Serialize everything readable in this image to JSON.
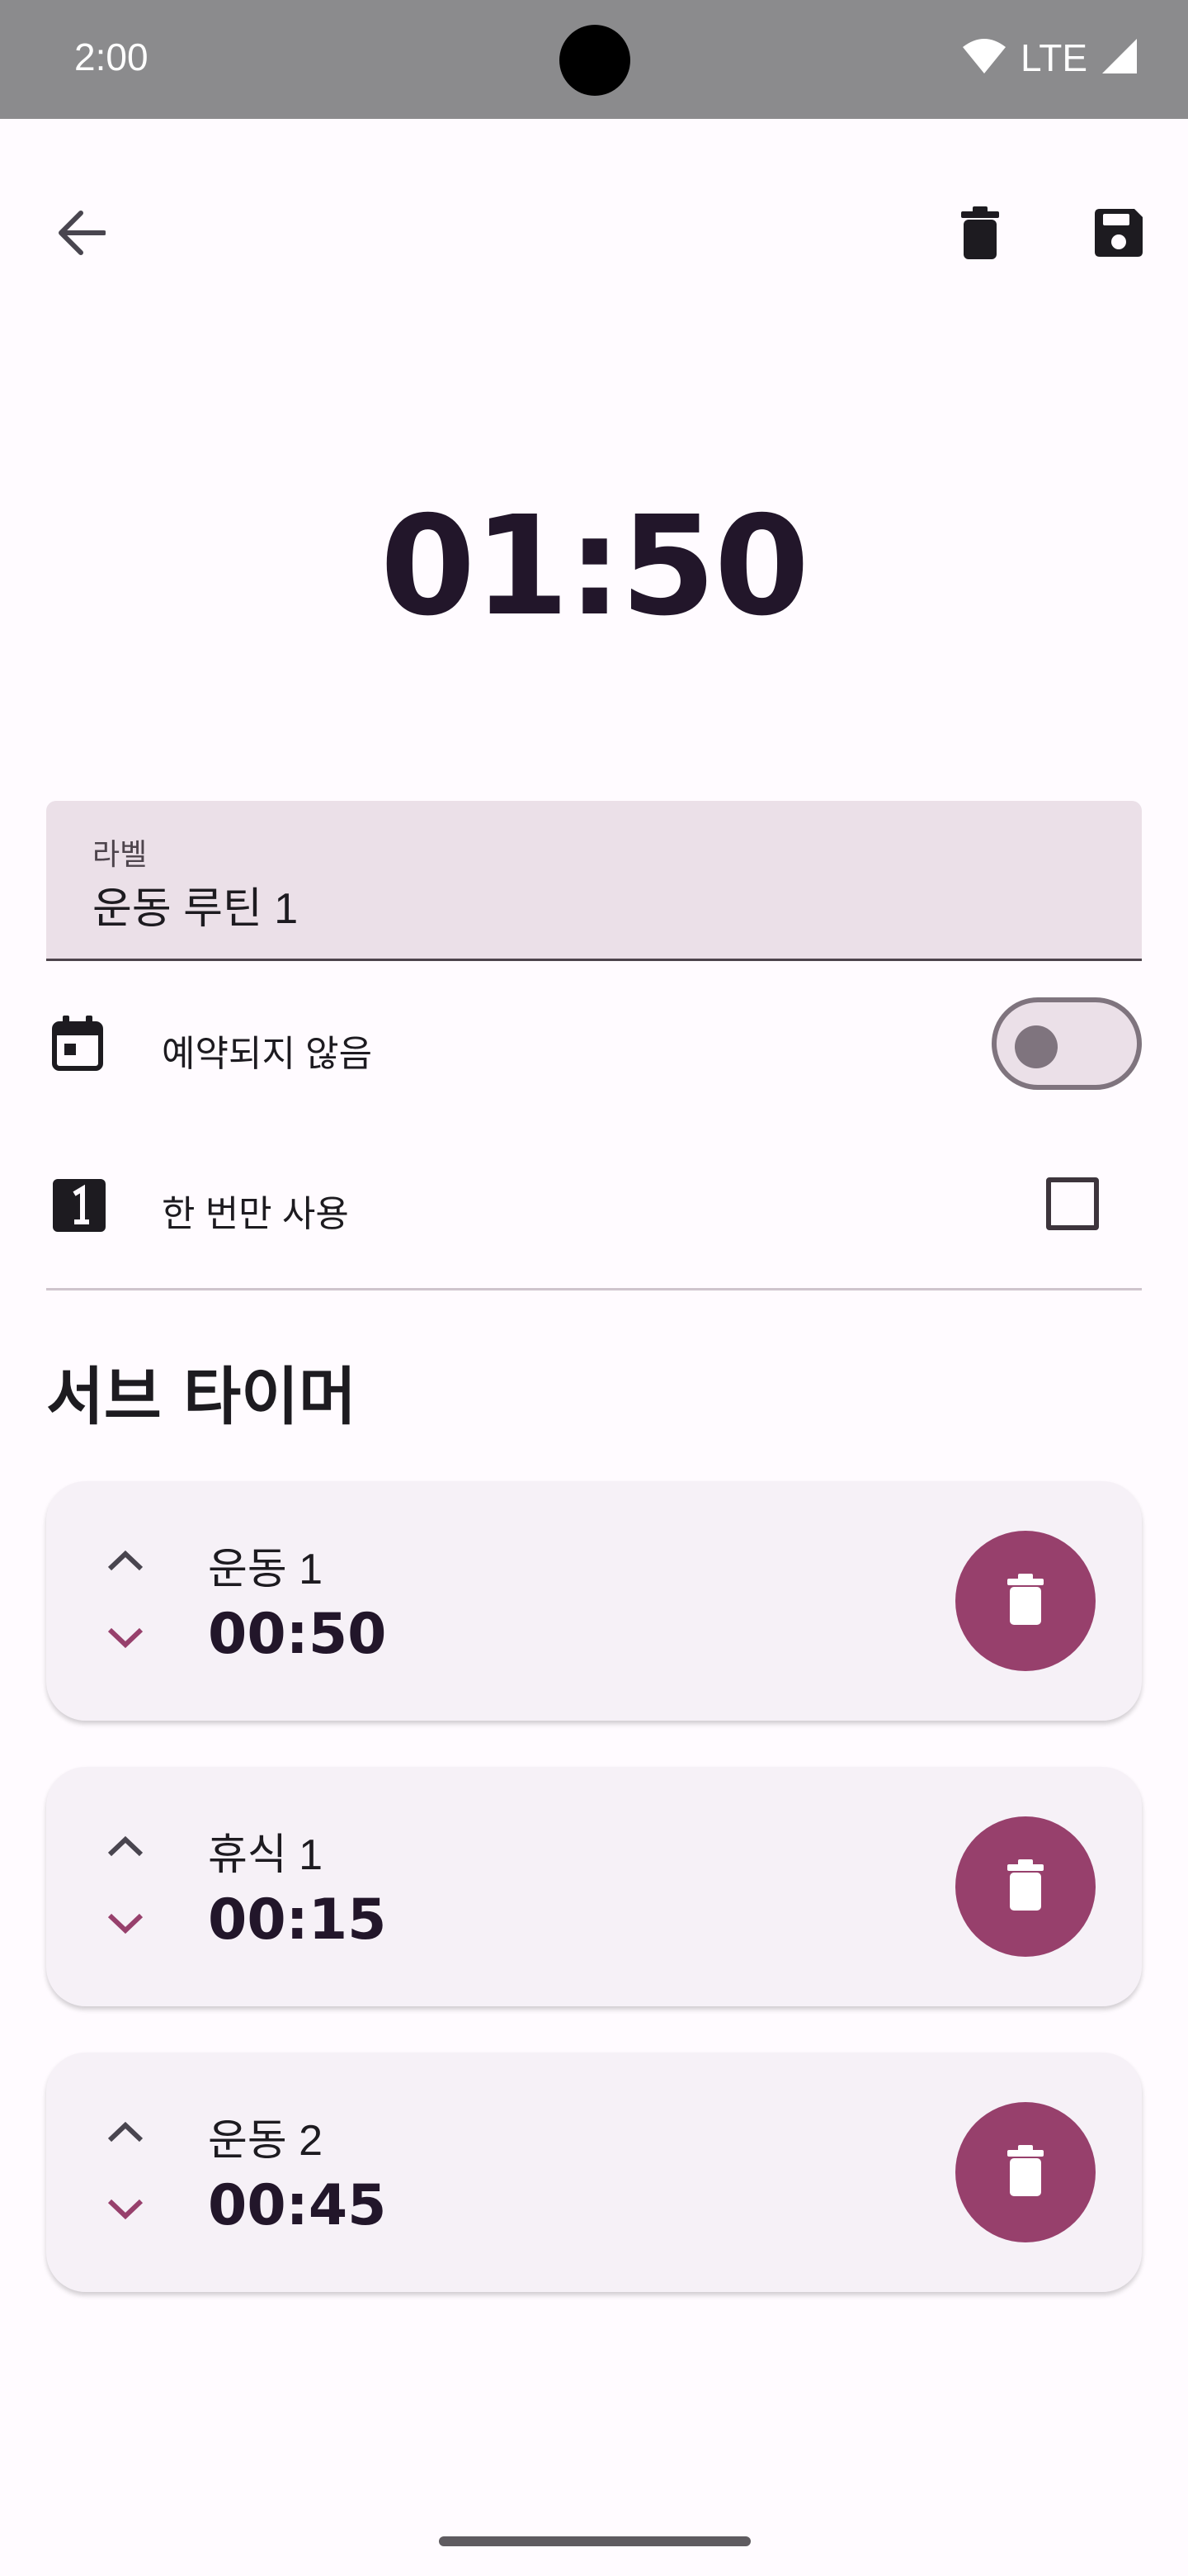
{
  "status_bar": {
    "time": "2:00",
    "network": "LTE"
  },
  "editor": {
    "total_time": "01:50",
    "label": {
      "caption": "라벨",
      "value": "운동 루틴 1"
    },
    "schedule": {
      "text": "예약되지 않음",
      "enabled": false
    },
    "one_time": {
      "text": "한 번만 사용",
      "checked": false
    }
  },
  "subtimers": {
    "title": "서브 타이머",
    "items": [
      {
        "name": "운동 1",
        "time": "00:50"
      },
      {
        "name": "휴식 1",
        "time": "00:15"
      },
      {
        "name": "운동 2",
        "time": "00:45"
      }
    ]
  },
  "colors": {
    "accent": "#97406C",
    "field_bg": "#EBE0E8",
    "card_bg": "#F6F1F7",
    "status_bar_bg": "#8B8B8D"
  },
  "icons": {
    "back": "arrow-left-icon",
    "delete": "trash-icon",
    "save": "floppy-disk-icon",
    "schedule": "calendar-icon",
    "one_time": "number-one-box-icon",
    "move_up": "chevron-up-icon",
    "move_down": "chevron-down-icon"
  }
}
